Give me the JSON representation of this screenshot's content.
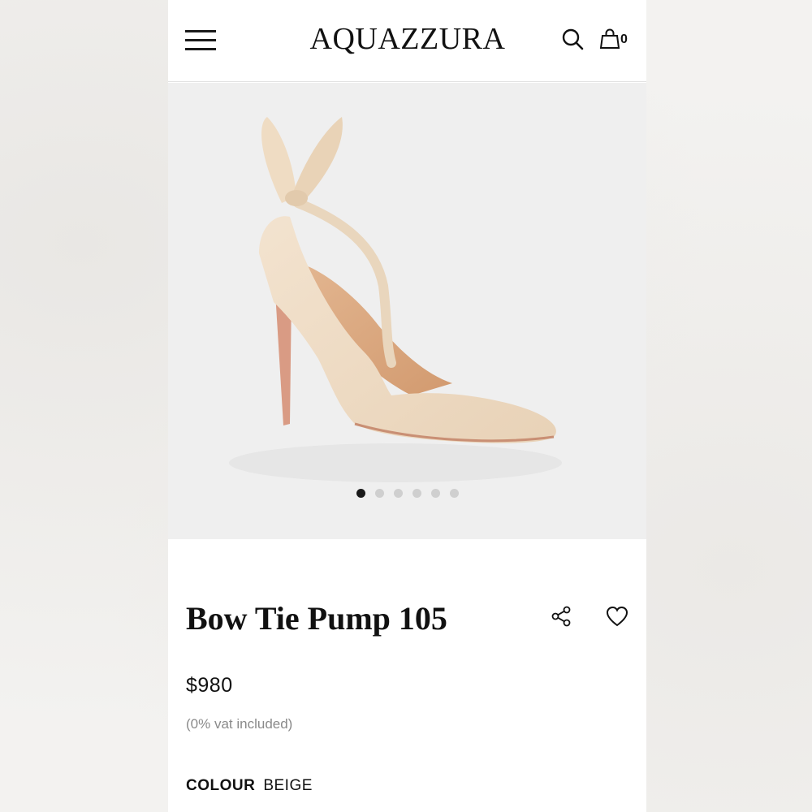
{
  "header": {
    "brand": "AQUAZZURA",
    "bag_count": "0"
  },
  "gallery": {
    "image_count": 6,
    "active_index": 0
  },
  "product": {
    "name": "Bow Tie Pump 105",
    "price": "$980",
    "vat_note": "(0% vat included)",
    "colour_label": "COLOUR",
    "colour_value": "BEIGE"
  },
  "icons": {
    "menu": "hamburger-icon",
    "search": "search-icon",
    "bag": "shopping-bag-icon",
    "share": "share-icon",
    "wishlist": "heart-icon"
  }
}
